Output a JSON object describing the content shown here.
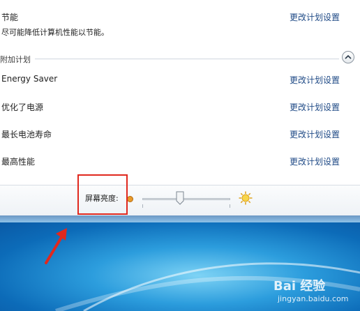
{
  "plans": {
    "current": {
      "name": "节能",
      "description": "尽可能降低计算机性能以节能。",
      "link": "更改计划设置"
    },
    "section_label": "附加计划",
    "items": [
      {
        "name": "Energy Saver",
        "link": "更改计划设置"
      },
      {
        "name": "优化了电源",
        "link": "更改计划设置"
      },
      {
        "name": "最长电池寿命",
        "link": "更改计划设置"
      },
      {
        "name": "最高性能",
        "link": "更改计划设置"
      }
    ]
  },
  "footer": {
    "brightness_label": "屏幕亮度:",
    "brightness_level": 0.43
  },
  "colors": {
    "link": "#1f4a86",
    "highlight": "#e0281e"
  },
  "watermark": {
    "brand": "Bai 经验",
    "url": "jingyan.baidu.com"
  }
}
